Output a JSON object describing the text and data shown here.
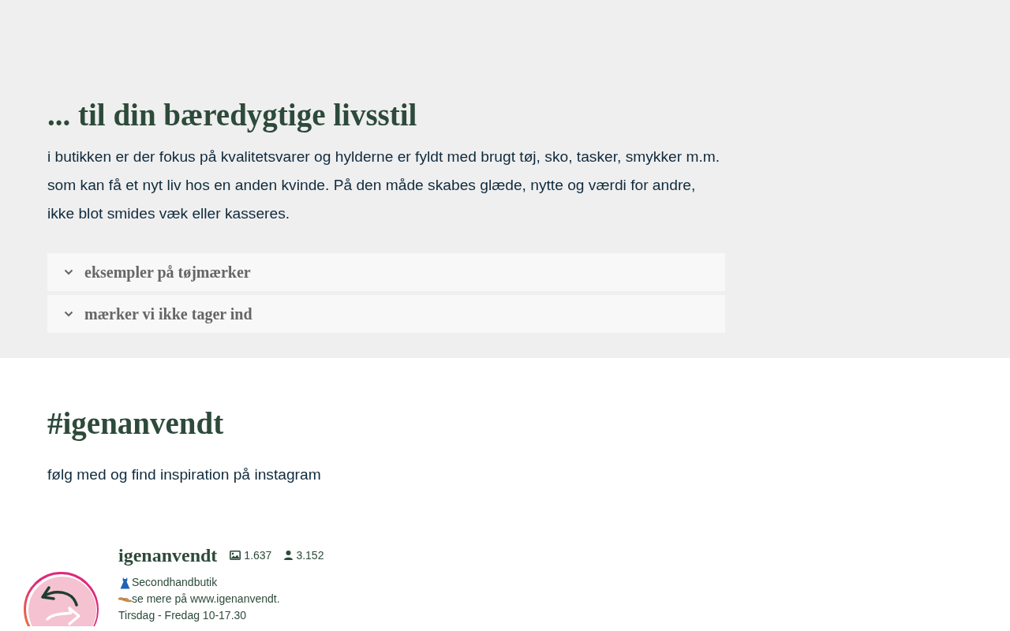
{
  "intro": {
    "heading": "... til din bæredygtige livsstil",
    "paragraph_lines": [
      "i butikken er der fokus på kvalitetsvarer og hylderne er fyldt med brugt tøj, sko, tasker, smykker m.m.",
      "som kan få et nyt liv hos en anden kvinde. På den måde skabes glæde, nytte og værdi for andre,",
      "ikke blot smides væk eller kasseres."
    ],
    "accordion": [
      {
        "label": "eksempler på tøjmærker",
        "expanded": false
      },
      {
        "label": "mærker vi ikke tager ind",
        "expanded": false
      }
    ]
  },
  "instagram": {
    "heading": "#igenanvendt",
    "text": "følg med og find inspiration på instagram",
    "profile": {
      "username": "igenanvendt",
      "posts": "1.637",
      "followers": "3.152",
      "bio": [
        {
          "kind": "dress",
          "text": "Secondhandbutik"
        },
        {
          "kind": "shoe",
          "text": "se mere på www.igenanvendt."
        },
        {
          "kind": "plain",
          "text": "Tirsdag - Fredag 10-17.30"
        }
      ]
    }
  }
}
